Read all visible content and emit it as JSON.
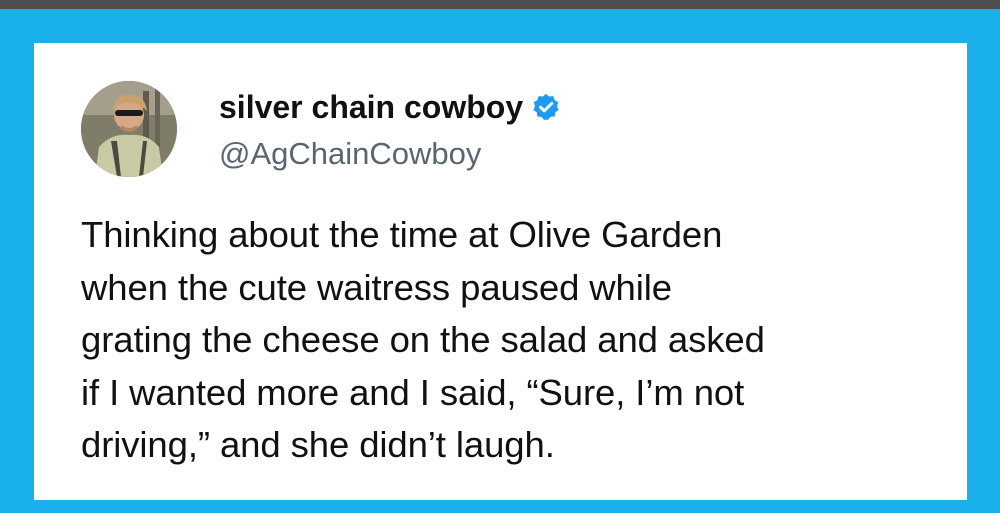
{
  "tweet": {
    "display_name": "silver chain cowboy",
    "handle": "@AgChainCowboy",
    "verified_icon": "verified-badge-icon",
    "text_lines": [
      "Thinking about the time at Olive Garden",
      "when the cute waitress paused while",
      "grating the cheese on the salad and asked",
      "if I wanted more and I said, “Sure, I’m not",
      "driving,” and she didn’t laugh."
    ]
  },
  "colors": {
    "frame_background": "#1ab0ee",
    "top_strip": "#4e4e50",
    "card_background": "#ffffff",
    "verified_badge": "#1d9bf0",
    "handle_text": "#5b6571"
  }
}
